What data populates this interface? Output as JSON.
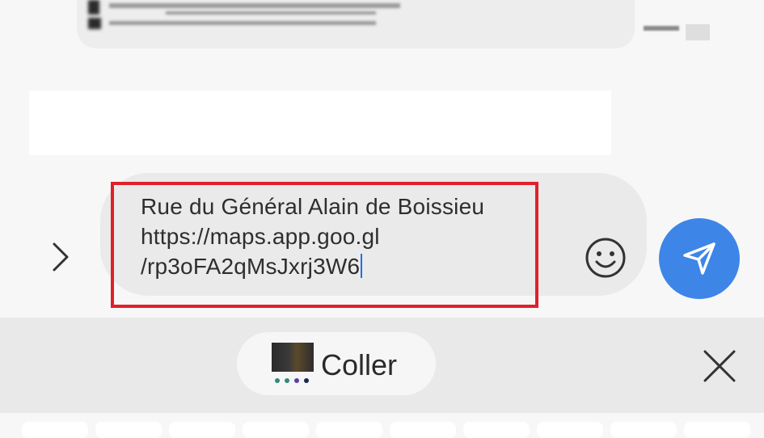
{
  "composer": {
    "message_text": "Rue du Général Alain de Boissieu\nhttps://maps.app.goo.gl\n/rp3oFA2qMsJxrj3W6",
    "expand_icon": "chevron-right-icon",
    "emoji_icon": "smiley-icon",
    "send_icon": "send-icon"
  },
  "clipboard": {
    "paste_label": "Coller",
    "close_icon": "close-icon"
  },
  "colors": {
    "accent": "#3d86e8",
    "highlight": "#e0202b",
    "caret": "#1a73e8"
  }
}
